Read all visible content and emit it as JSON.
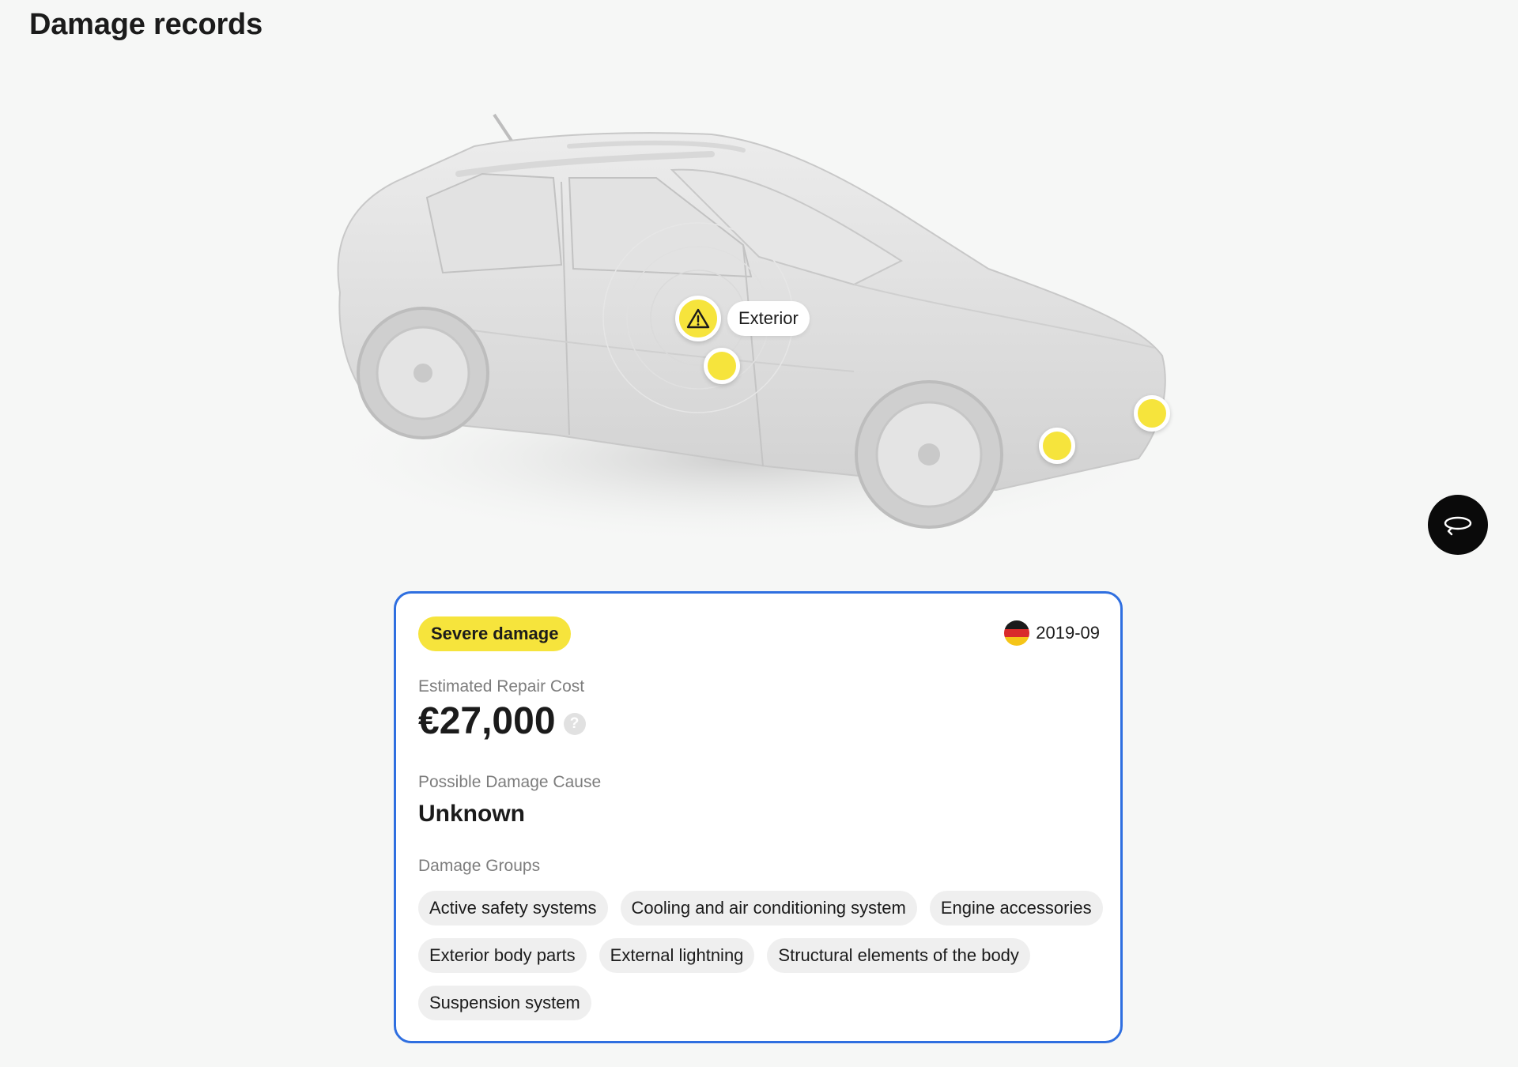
{
  "page": {
    "title": "Damage records"
  },
  "car_view": {
    "hotspot_label": "Exterior",
    "icons": {
      "main_hotspot": "warning-triangle-icon",
      "rotate": "rotate-360-icon"
    },
    "accent_color": "#f6e43c"
  },
  "damage_record": {
    "severity": "Severe damage",
    "date": "2019-09",
    "country_flag": "germany-flag",
    "cost_label": "Estimated Repair Cost",
    "cost_value": "€27,000",
    "cost_help_icon": "?",
    "cause_label": "Possible Damage Cause",
    "cause_value": "Unknown",
    "groups_label": "Damage Groups",
    "groups": [
      "Active safety systems",
      "Cooling and air conditioning system",
      "Engine accessories",
      "Exterior body parts",
      "External lightning",
      "Structural elements of the body",
      "Suspension system"
    ],
    "border_color": "#2f6fe0"
  }
}
